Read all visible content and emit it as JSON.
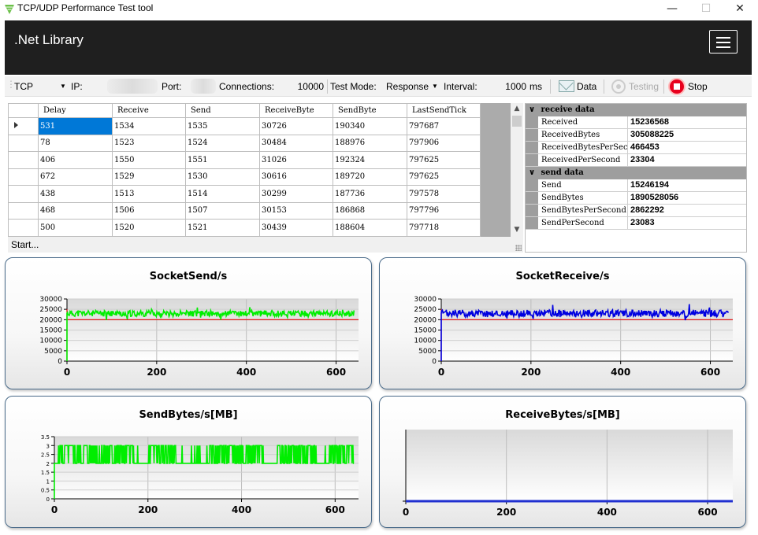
{
  "window": {
    "title": "TCP/UDP Performance Test tool",
    "minimize": "—",
    "maximize": "☐",
    "close": "✕"
  },
  "header": {
    "brand": ".Net Library"
  },
  "toolbar": {
    "protocol": "TCP",
    "ip_label": "IP:",
    "port_label": "Port:",
    "connections_label": "Connections:",
    "connections_value": "10000",
    "test_mode_label": "Test Mode:",
    "test_mode_value": "Response",
    "interval_label": "Interval:",
    "interval_value": "1000",
    "interval_unit": "ms",
    "data_button": "Data",
    "testing_button": "Testing",
    "stop_button": "Stop"
  },
  "grid": {
    "columns": [
      "Delay",
      "Receive",
      "Send",
      "ReceiveByte",
      "SendByte",
      "LastSendTick"
    ],
    "rows": [
      [
        "531",
        "1534",
        "1535",
        "30726",
        "190340",
        "797687"
      ],
      [
        "78",
        "1523",
        "1524",
        "30484",
        "188976",
        "797906"
      ],
      [
        "406",
        "1550",
        "1551",
        "31026",
        "192324",
        "797625"
      ],
      [
        "672",
        "1529",
        "1530",
        "30616",
        "189720",
        "797625"
      ],
      [
        "438",
        "1513",
        "1514",
        "30299",
        "187736",
        "797578"
      ],
      [
        "468",
        "1506",
        "1507",
        "30153",
        "186868",
        "797796"
      ],
      [
        "500",
        "1520",
        "1521",
        "30439",
        "188604",
        "797718"
      ]
    ]
  },
  "status": {
    "text": "Start..."
  },
  "props": {
    "receive_title": "receive data",
    "receive": [
      {
        "k": "Received",
        "v": "15236568"
      },
      {
        "k": "ReceivedBytes",
        "v": "305088225"
      },
      {
        "k": "ReceivedBytesPerSecond",
        "v": "466453"
      },
      {
        "k": "ReceivedPerSecond",
        "v": "23304"
      }
    ],
    "send_title": "send data",
    "send": [
      {
        "k": "Send",
        "v": "15246194"
      },
      {
        "k": "SendBytes",
        "v": "1890528056"
      },
      {
        "k": "SendBytesPerSecond",
        "v": "2862292"
      },
      {
        "k": "SendPerSecond",
        "v": "23083"
      }
    ]
  },
  "chart_data": [
    {
      "type": "line",
      "title": "SocketSend/s",
      "xlim": [
        0,
        650
      ],
      "xticks": [
        0,
        200,
        400,
        600
      ],
      "ylim": [
        0,
        30000
      ],
      "yticks": [
        0,
        5000,
        10000,
        15000,
        20000,
        25000,
        30000
      ],
      "series": [
        {
          "color": "#00ee00",
          "level": 23000,
          "noise": 1500
        }
      ],
      "ref_line": {
        "value": 20000,
        "color": "#e00000"
      }
    },
    {
      "type": "line",
      "title": "SocketReceive/s",
      "xlim": [
        0,
        650
      ],
      "xticks": [
        0,
        200,
        400,
        600
      ],
      "ylim": [
        0,
        30000
      ],
      "yticks": [
        0,
        5000,
        10000,
        15000,
        20000,
        25000,
        30000
      ],
      "series": [
        {
          "color": "#0000e0",
          "level": 23000,
          "noise": 1800
        }
      ],
      "ref_line": {
        "value": 20000,
        "color": "#e00000"
      }
    },
    {
      "type": "line",
      "title": "SendBytes/s[MB]",
      "xlim": [
        0,
        650
      ],
      "xticks": [
        0,
        200,
        400,
        600
      ],
      "ylim": [
        0,
        3.5
      ],
      "yticks": [
        0,
        0.5,
        1,
        1.5,
        2,
        2.5,
        3,
        3.5
      ],
      "series": [
        {
          "color": "#00ee00",
          "low": 2,
          "high": 3
        }
      ]
    },
    {
      "type": "line",
      "title": "ReceiveBytes/s[MB]",
      "xlim": [
        0,
        650
      ],
      "xticks": [
        0,
        200,
        400,
        600
      ],
      "ylim": [
        0,
        1
      ],
      "yticks": [],
      "series": [
        {
          "color": "#2030d0",
          "value": 0
        }
      ]
    }
  ]
}
